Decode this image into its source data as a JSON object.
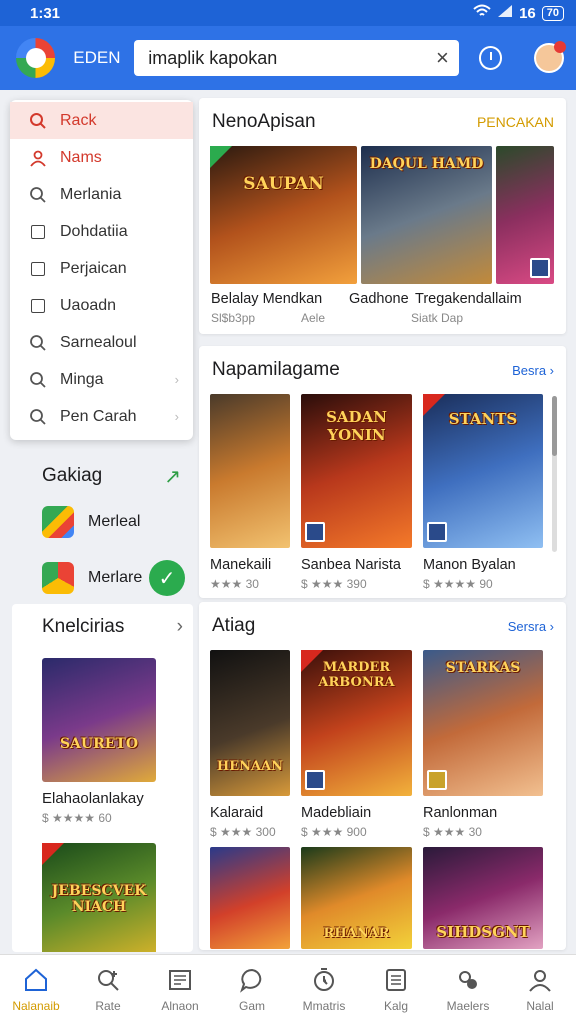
{
  "status": {
    "time": "1:31",
    "right": "16",
    "battery": "70"
  },
  "appbar": {
    "brand": "EDEN",
    "search_value": "imaplik kapokan",
    "colors": {
      "primary": "#2e72e6",
      "status": "#1e63d6"
    }
  },
  "menu": {
    "items": [
      {
        "label": "Rack",
        "icon": "search-icon"
      },
      {
        "label": "Nams",
        "icon": "user-icon"
      },
      {
        "label": "Merlania",
        "icon": "search-icon"
      },
      {
        "label": "Dohdatiia",
        "icon": "checkbox-icon"
      },
      {
        "label": "Perjaican",
        "icon": "checkbox-icon"
      },
      {
        "label": "Uaoadn",
        "icon": "checkbox-icon"
      },
      {
        "label": "Sarnealoul",
        "icon": "search-icon"
      },
      {
        "label": "Minga",
        "icon": "search-icon"
      },
      {
        "label": "Pen Carah",
        "icon": "search-icon"
      }
    ]
  },
  "gakiag": {
    "title": "Gakiag",
    "apps": [
      {
        "label": "Merleal"
      },
      {
        "label": "Merlare"
      }
    ]
  },
  "kndl": {
    "title": "Knelcirias",
    "game1": {
      "art": "SAURETO",
      "title": "Elahaolanlakay",
      "sub": "$ ★★★★ 60"
    },
    "game2": {
      "art": "JEBESCVEK NIACH"
    }
  },
  "sec1": {
    "title": "NenoApisan",
    "link": "PENCAKAN",
    "arts": [
      "SAUPAN",
      "DAQUL HAMD",
      ""
    ],
    "captions": [
      "Belalay Mendkan",
      "Gadhone",
      "Tregakendallaim"
    ],
    "subs": [
      "Sl$b3pp",
      "Aele",
      "Siatk Dap"
    ]
  },
  "sec2": {
    "title": "Napamilagame",
    "link": "Besra ›",
    "arts": [
      "",
      "SADAN YONIN",
      "STANTS"
    ],
    "captions": [
      "Manekaili",
      "Sanbea Narista",
      "Manon Byalan"
    ],
    "subs": [
      "★★★ 30",
      "$ ★★★ 390",
      "$ ★★★★ 90"
    ]
  },
  "sec3": {
    "title": "Atiag",
    "link": "Sersra ›",
    "arts": [
      "HENAAN",
      "MARDER ARBONRA",
      "STARKAS",
      "",
      "RHANAR",
      "SIHDSGNT"
    ],
    "captions": [
      "Kalaraid",
      "Madebliain",
      "Ranlonman"
    ],
    "subs": [
      "$ ★★★ 300",
      "$ ★★★ 900",
      "$ ★★★ 30"
    ]
  },
  "bottom_nav": [
    {
      "label": "Nalanaib",
      "icon": "home-icon"
    },
    {
      "label": "Rate",
      "icon": "search-plus-icon"
    },
    {
      "label": "Alnaon",
      "icon": "library-icon"
    },
    {
      "label": "Gam",
      "icon": "chat-icon"
    },
    {
      "label": "Mmatris",
      "icon": "timer-icon"
    },
    {
      "label": "Kalg",
      "icon": "list-icon"
    },
    {
      "label": "Maelers",
      "icon": "controller-icon"
    },
    {
      "label": "Nalal",
      "icon": "person-icon"
    }
  ]
}
